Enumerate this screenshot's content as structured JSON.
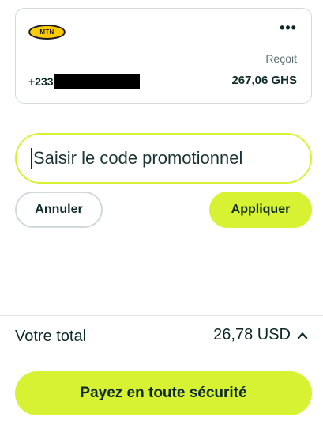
{
  "card": {
    "provider_logo_text": "MTN",
    "more_icon": "more-horizontal-icon",
    "receives_label": "Reçoit",
    "phone_prefix": "+233",
    "amount": "267,06 GHS"
  },
  "promo": {
    "placeholder": "Saisir le code promotionnel",
    "value": ""
  },
  "buttons": {
    "cancel": "Annuler",
    "apply": "Appliquer",
    "pay": "Payez en toute sécurité"
  },
  "total": {
    "label": "Votre total",
    "value": "26,78 USD",
    "toggle_icon": "chevron-up-icon"
  },
  "colors": {
    "accent": "#d6f233",
    "text": "#0f2a2a",
    "border": "#d3d9db",
    "mtn_yellow": "#ffcb05"
  }
}
